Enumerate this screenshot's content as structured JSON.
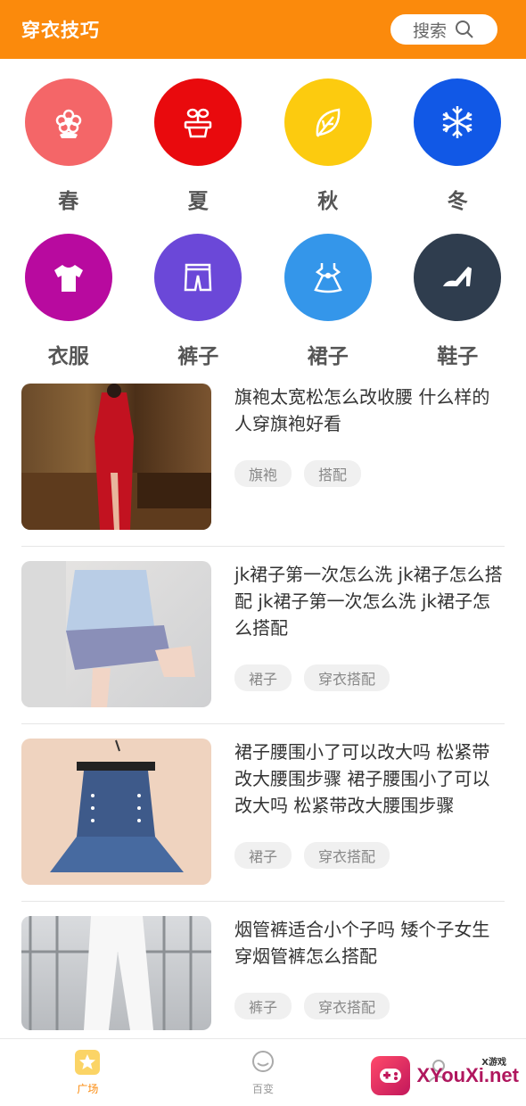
{
  "header": {
    "title": "穿衣技巧",
    "search_label": "搜索"
  },
  "categories": [
    {
      "label": "春",
      "color": "#f46668",
      "icon": "flower-icon"
    },
    {
      "label": "夏",
      "color": "#e90a0d",
      "icon": "potted-plant-icon"
    },
    {
      "label": "秋",
      "color": "#fccb0f",
      "icon": "leaf-icon"
    },
    {
      "label": "冬",
      "color": "#1158e6",
      "icon": "snowflake-icon"
    },
    {
      "label": "衣服",
      "color": "#b80a9f",
      "icon": "tshirt-icon"
    },
    {
      "label": "裤子",
      "color": "#6b48d8",
      "icon": "shorts-icon"
    },
    {
      "label": "裙子",
      "color": "#3496ea",
      "icon": "dress-icon"
    },
    {
      "label": "鞋子",
      "color": "#2f3d4e",
      "icon": "high-heel-icon"
    }
  ],
  "articles": [
    {
      "title": "旗袍太宽松怎么改收腰 什么样的人穿旗袍好看",
      "tags": [
        "旗袍",
        "搭配"
      ]
    },
    {
      "title": "jk裙子第一次怎么洗 jk裙子怎么搭配 jk裙子第一次怎么洗 jk裙子怎么搭配",
      "tags": [
        "裙子",
        "穿衣搭配"
      ]
    },
    {
      "title": "裙子腰围小了可以改大吗 松紧带改大腰围步骤 裙子腰围小了可以改大吗 松紧带改大腰围步骤",
      "tags": [
        "裙子",
        "穿衣搭配"
      ]
    },
    {
      "title": "烟管裤适合小个子吗 矮个子女生穿烟管裤怎么搭配",
      "tags": [
        "裤子",
        "穿衣搭配"
      ]
    }
  ],
  "bottom_nav": [
    {
      "label": "广场",
      "icon": "star-icon",
      "active": true
    },
    {
      "label": "百变",
      "icon": "chat-bubble-icon",
      "active": false
    },
    {
      "label": "",
      "icon": "profile-icon",
      "active": false
    }
  ],
  "watermark": {
    "text": "XYouXi.net",
    "small": "X游戏"
  },
  "colors": {
    "accent": "#fb8a0c"
  }
}
